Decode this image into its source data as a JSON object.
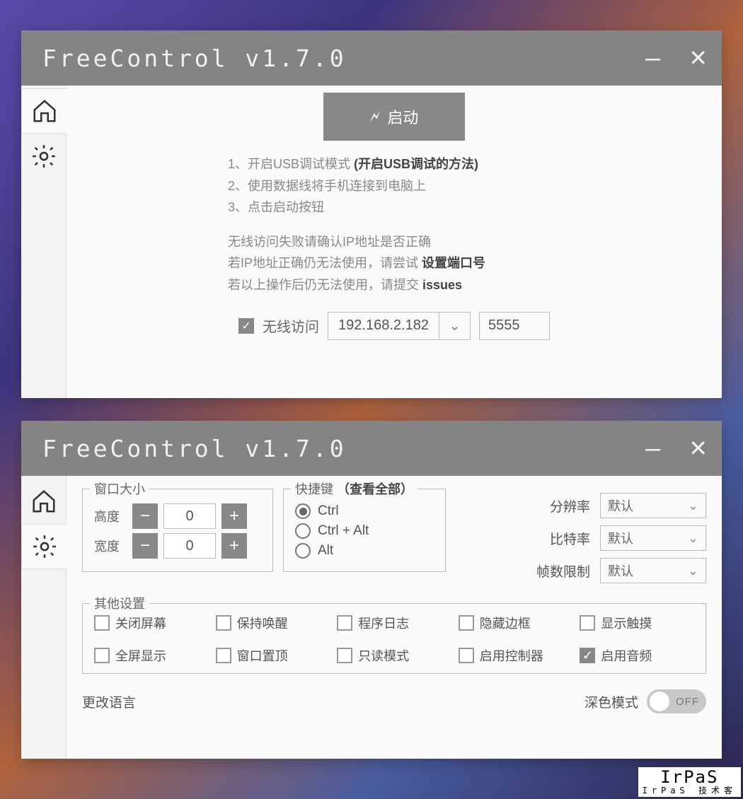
{
  "app": {
    "title": "FreeControl v1.7.0"
  },
  "titlebar": {
    "minimize": "–",
    "close": "✕"
  },
  "launch": {
    "label": "启动",
    "bolt": "🗲"
  },
  "instructions": {
    "a": "1、开启USB调试模式 ",
    "a_bold": "(开启USB调试的方法)",
    "b": "2、使用数据线将手机连接到电脑上",
    "c": "3、点击启动按钮",
    "d": "无线访问失败请确认IP地址是否正确",
    "e_pre": "若IP地址正确仍无法使用，请尝试 ",
    "e_bold": "设置端口号",
    "f_pre": "若以上操作后仍无法使用，请提交 ",
    "f_bold": "issues"
  },
  "wireless": {
    "label": "无线访问",
    "ip": "192.168.2.182",
    "port": "5555"
  },
  "settings": {
    "winsize": {
      "legend": "窗口大小",
      "height_label": "高度",
      "width_label": "宽度",
      "height": "0",
      "width": "0"
    },
    "shortcut": {
      "legend_text": "快捷键 ",
      "legend_link": "（查看全部）",
      "o1": "Ctrl",
      "o2": "Ctrl + Alt",
      "o3": "Alt"
    },
    "display": {
      "res_label": "分辨率",
      "bitrate_label": "比特率",
      "fps_label": "帧数限制",
      "default": "默认"
    },
    "other": {
      "legend": "其他设置",
      "c1": "关闭屏幕",
      "c2": "保持唤醒",
      "c3": "程序日志",
      "c4": "隐藏边框",
      "c5": "显示触摸",
      "c6": "全屏显示",
      "c7": "窗口置顶",
      "c8": "只读模式",
      "c9": "启用控制器",
      "c10": "启用音频"
    },
    "lang_label": "更改语言",
    "dark_label": "深色模式",
    "off": "OFF"
  },
  "watermark": {
    "main": "IrPaS",
    "sub": "IrPaS 技术客"
  }
}
